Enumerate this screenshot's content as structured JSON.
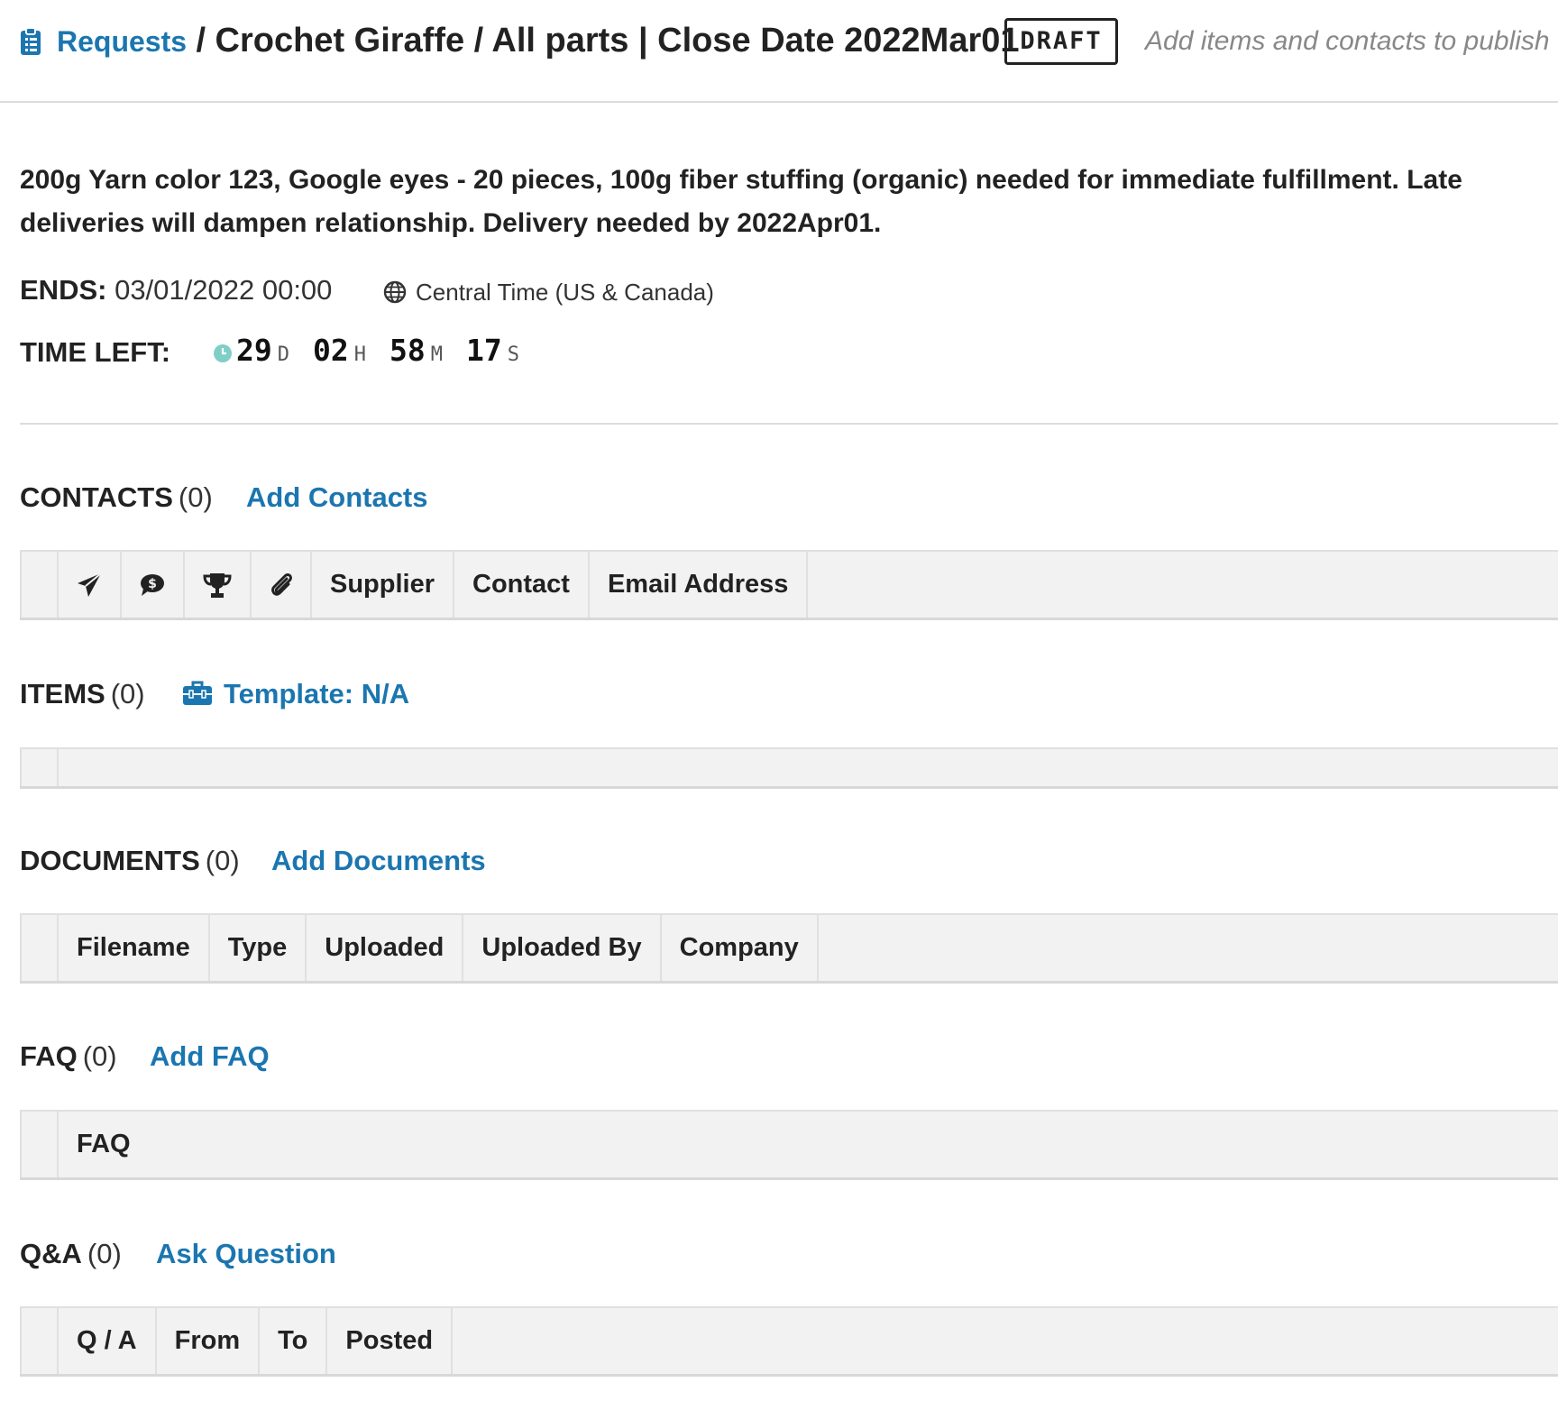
{
  "header": {
    "breadcrumb_link": "Requests",
    "separator": "/",
    "title": "Crochet Giraffe / All parts | Close Date 2022Mar01",
    "status_badge": "DRAFT",
    "publish_hint": "Add items and contacts to publish"
  },
  "description": "200g Yarn color 123, Google eyes - 20 pieces, 100g fiber stuffing (organic) needed for immediate fulfillment.  Late deliveries will dampen relationship.  Delivery needed by 2022Apr01.",
  "ends": {
    "label": "ENDS:",
    "value": "03/01/2022 00:00",
    "timezone": "Central Time (US & Canada)"
  },
  "time_left": {
    "label": "TIME LEFT:",
    "days": "29",
    "days_unit": "D",
    "hours": "02",
    "hours_unit": "H",
    "minutes": "58",
    "minutes_unit": "M",
    "seconds": "17",
    "seconds_unit": "S"
  },
  "contacts": {
    "title": "CONTACTS",
    "count": "(0)",
    "action": "Add Contacts",
    "icon_columns": [
      "paper-plane-icon",
      "dollar-chat-icon",
      "trophy-icon",
      "paperclip-icon"
    ],
    "columns": [
      "Supplier",
      "Contact",
      "Email Address"
    ]
  },
  "items": {
    "title": "ITEMS",
    "count": "(0)",
    "action": "Template: N/A",
    "action_icon": "toolbox-icon"
  },
  "documents": {
    "title": "DOCUMENTS",
    "count": "(0)",
    "action": "Add Documents",
    "columns": [
      "Filename",
      "Type",
      "Uploaded",
      "Uploaded By",
      "Company"
    ]
  },
  "faq": {
    "title": "FAQ",
    "count": "(0)",
    "action": "Add FAQ",
    "columns": [
      "FAQ"
    ]
  },
  "qa": {
    "title": "Q&A",
    "count": "(0)",
    "action": "Ask Question",
    "columns": [
      "Q / A",
      "From",
      "To",
      "Posted"
    ]
  },
  "colors": {
    "link": "#1b76b0",
    "clock": "#7fcfc8",
    "table_header_bg": "#f2f2f2",
    "hint": "#888888"
  }
}
